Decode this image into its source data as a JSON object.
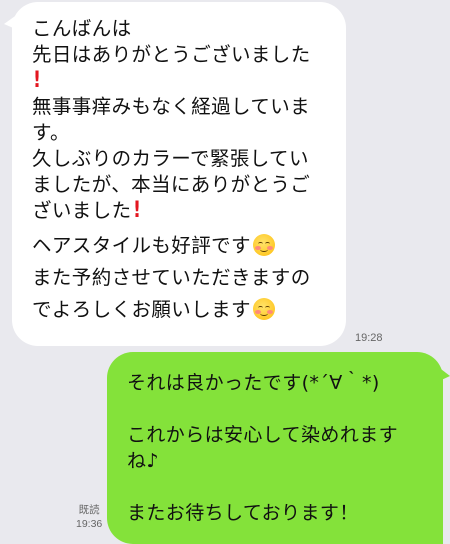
{
  "incoming_message": {
    "lines": [
      "こんばんは",
      "先日はありがとうございました",
      "",
      "無事事痒みもなく経過していま",
      "す。",
      "久しぶりのカラーで緊張してい",
      "ましたが、本当にありがとうご",
      "ざいました",
      "ヘアスタイルも好評です",
      "また予約させていただきますの",
      "でよろしくお願いします"
    ],
    "time": "19:28"
  },
  "outgoing_message": {
    "lines": [
      "それは良かったです(*´∀｀*)",
      "",
      "これからは安心して染めれます",
      "ね♪",
      "",
      "またお待ちしております！"
    ],
    "read_label": "既読",
    "time": "19:36"
  },
  "colors": {
    "background": "#e9e9ee",
    "incoming_bubble": "#ffffff",
    "outgoing_bubble": "#84e23a",
    "exclamation": "#e3161f"
  },
  "icons": [
    "red-exclamation-icon",
    "smiling-blush-emoji-icon"
  ]
}
